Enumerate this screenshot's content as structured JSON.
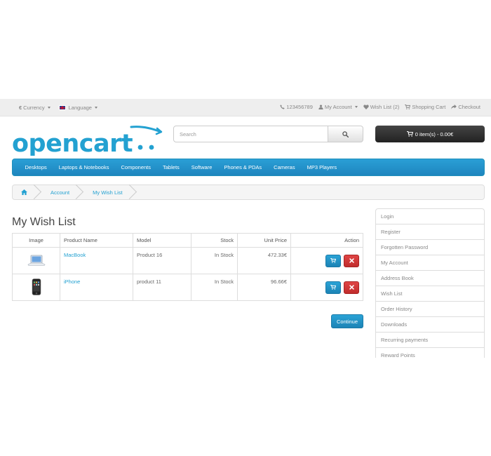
{
  "topbar": {
    "currency": "Currency",
    "language": "Language",
    "phone": "123456789",
    "my_account": "My Account",
    "wish_list": "Wish List (2)",
    "shopping_cart": "Shopping Cart",
    "checkout": "Checkout"
  },
  "logo": {
    "text": "opencart",
    "color": "#23a1d1"
  },
  "search": {
    "placeholder": "Search"
  },
  "cart": {
    "label": "0 item(s) - 0.00€"
  },
  "menu": {
    "items": [
      "Desktops",
      "Laptops & Notebooks",
      "Components",
      "Tablets",
      "Software",
      "Phones & PDAs",
      "Cameras",
      "MP3 Players"
    ]
  },
  "breadcrumb": {
    "home_icon": "home-icon",
    "items": [
      "Account",
      "My Wish List"
    ]
  },
  "page": {
    "title": "My Wish List",
    "continue_label": "Continue"
  },
  "table": {
    "headers": {
      "image": "Image",
      "name": "Product Name",
      "model": "Model",
      "stock": "Stock",
      "price": "Unit Price",
      "action": "Action"
    },
    "rows": [
      {
        "name": "MacBook",
        "model": "Product 16",
        "stock": "In Stock",
        "price": "472.33€",
        "image_icon": "laptop-icon"
      },
      {
        "name": "iPhone",
        "model": "product 11",
        "stock": "In Stock",
        "price": "96.66€",
        "image_icon": "phone-icon"
      }
    ]
  },
  "sidebar": {
    "items": [
      "Login",
      "Register",
      "Forgotten Password",
      "My Account",
      "Address Book",
      "Wish List",
      "Order History",
      "Downloads",
      "Recurring payments",
      "Reward Points"
    ]
  },
  "colors": {
    "accent": "#23a1d1",
    "menu": "#229ac8",
    "danger": "#d43f3a",
    "cart_bg": "#333333"
  }
}
